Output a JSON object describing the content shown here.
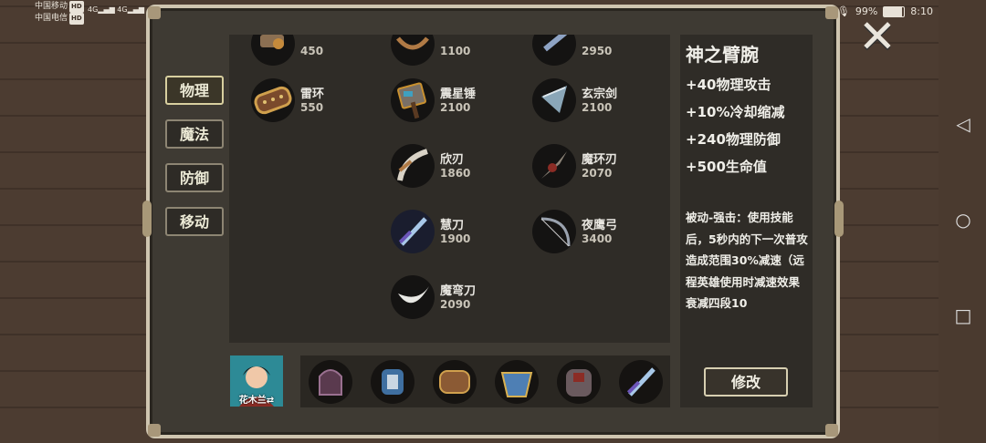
{
  "status_bar": {
    "carrier1": "中国移动",
    "carrier2": "中国电信",
    "hd": "HD",
    "signal": "4G",
    "battery": "99%",
    "time": "8:10"
  },
  "categories": [
    "物理",
    "魔法",
    "防御",
    "移动"
  ],
  "items": [
    {
      "name": "",
      "price": "450"
    },
    {
      "name": "",
      "price": "1100"
    },
    {
      "name": "",
      "price": "2950"
    },
    {
      "name": "雷环",
      "price": "550"
    },
    {
      "name": "震星锤",
      "price": "2100"
    },
    {
      "name": "玄宗剑",
      "price": "2100"
    },
    {
      "name": "欣刃",
      "price": "1860"
    },
    {
      "name": "魔环刃",
      "price": "2070"
    },
    {
      "name": "慧刀",
      "price": "1900"
    },
    {
      "name": "夜鹰弓",
      "price": "3400"
    },
    {
      "name": "魔弯刀",
      "price": "2090"
    }
  ],
  "detail": {
    "title": "神之臂腕",
    "stats": [
      "+40物理攻击",
      "+10%冷却缩减",
      "+240物理防御",
      "+500生命值"
    ],
    "description": "被动-强击：使用技能后，5秒内的下一次普攻造成范围30%减速（远程英雄使用时减速效果衰减四段10"
  },
  "modify_label": "修改",
  "hero": {
    "label": "花木兰⇄"
  },
  "close_label": "✕",
  "colors": {
    "accent": "#d8cf9f",
    "panel": "#2f2c27",
    "frame": "#cfc5b0"
  }
}
